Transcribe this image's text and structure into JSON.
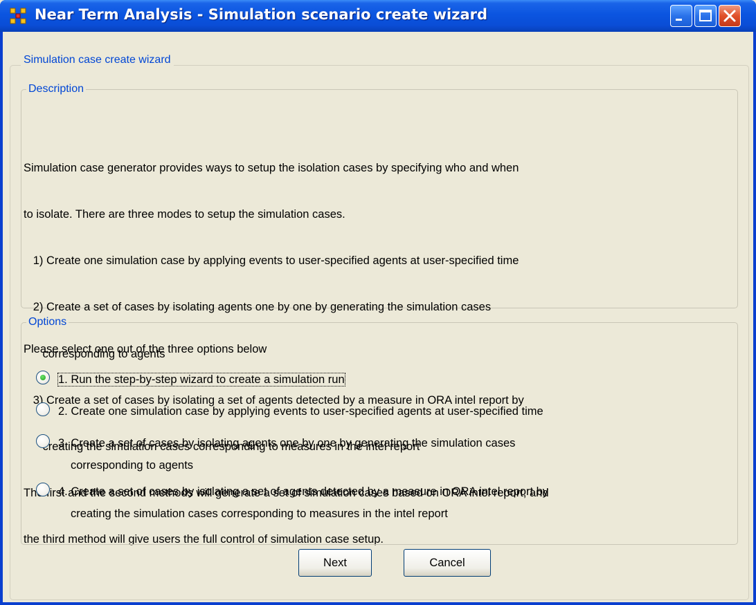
{
  "window": {
    "title": "Near Term Analysis - Simulation scenario create wizard",
    "title_color": "#ffffff",
    "titlebar_color": "#0b55e0",
    "icons": [
      "app-icon",
      "minimize-icon",
      "maximize-icon",
      "close-icon"
    ]
  },
  "wizard": {
    "panel_title": "Simulation case create wizard",
    "legend_color": "#0046d5"
  },
  "description": {
    "legend": "Description",
    "lines": [
      "Simulation case generator provides ways to setup the isolation cases by specifying who and when",
      "to isolate. There are three modes to setup the simulation cases.",
      "   1) Create one simulation case by applying events to user-specified agents at user-specified time",
      "   2) Create a set of cases by isolating agents one by one by generating the simulation cases",
      "      corresponding to agents",
      "   3) Create a set of cases by isolating a set of agents detected by a measure in ORA intel report by",
      "      creating the simulation cases corresponding to measures in the intel report",
      "The first and the second methods will generate a set of simulation cases based on ORA intel report, and",
      "the third method will give users the full control of simulation case setup."
    ]
  },
  "options": {
    "legend": "Options",
    "prompt": "Please select one out of the three options below",
    "selected_index": 0,
    "items": [
      {
        "lines": [
          "1. Run the step-by-step wizard to create a simulation run"
        ]
      },
      {
        "lines": [
          "2. Create one simulation case by applying events to user-specified agents at user-specified time"
        ]
      },
      {
        "lines": [
          "3. Create a set of cases by isolating agents one by one by generating the simulation cases",
          "corresponding to agents"
        ]
      },
      {
        "lines": [
          "4. Create a set of cases by isolating a set of agents detected by a measure in ORA intel report by",
          "creating the simulation cases corresponding to measures in the intel report"
        ]
      }
    ]
  },
  "buttons": {
    "next": "Next",
    "cancel": "Cancel"
  }
}
